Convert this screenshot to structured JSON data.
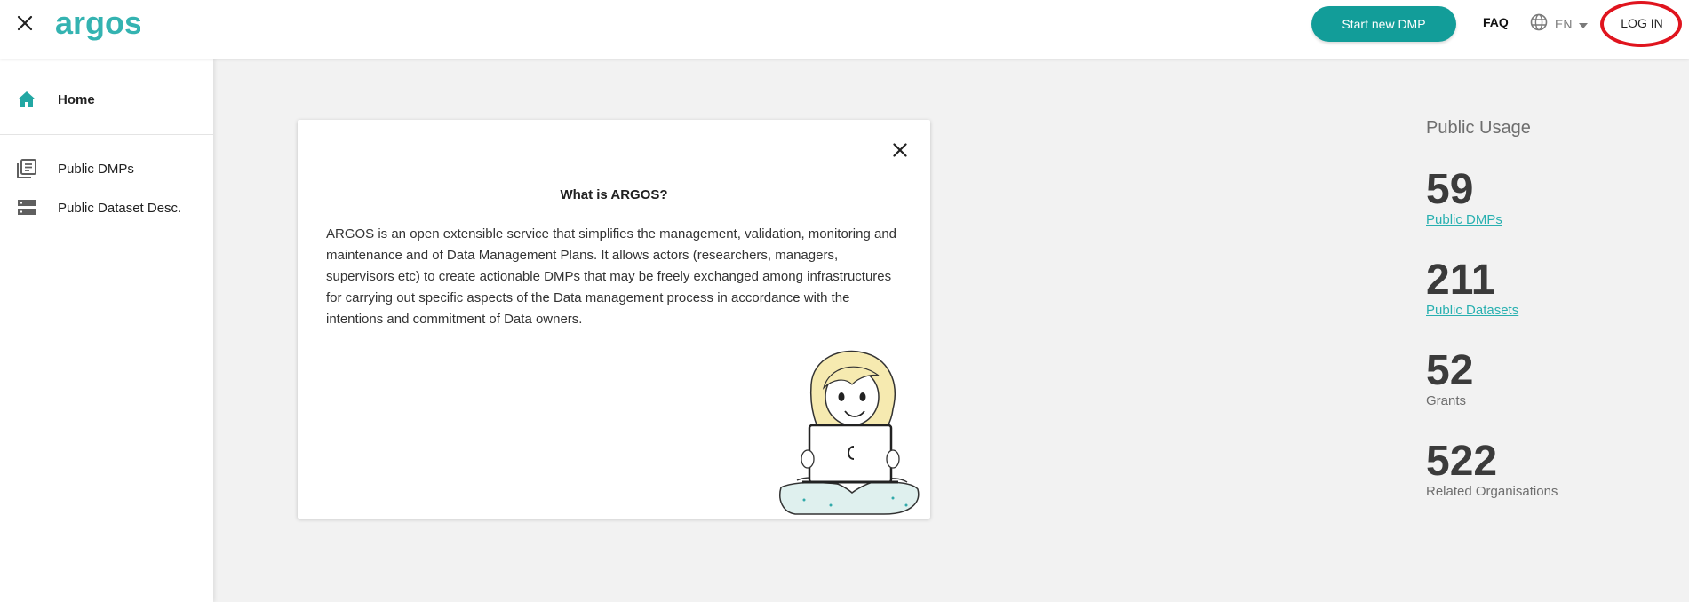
{
  "header": {
    "logo_text": "argos",
    "start_button_label": "Start new DMP",
    "faq_label": "FAQ",
    "language_label": "EN",
    "login_label": "LOG IN"
  },
  "sidebar": {
    "items": [
      {
        "label": "Home",
        "icon": "home-icon",
        "active": true
      },
      {
        "label": "Public DMPs",
        "icon": "library-books-icon",
        "active": false
      },
      {
        "label": "Public Dataset Desc.",
        "icon": "storage-icon",
        "active": false
      }
    ]
  },
  "info_card": {
    "title": "What is ARGOS?",
    "text": "ARGOS is an open extensible service that simplifies the management, validation, monitoring and maintenance and of Data Management Plans. It allows actors (researchers, managers, supervisors etc) to create actionable DMPs that may be freely exchanged among infrastructures for carrying out specific aspects of the Data management process in accordance with the intentions and commitment of Data owners."
  },
  "public_usage": {
    "title": "Public Usage",
    "stats": [
      {
        "value": "59",
        "label": "Public DMPs",
        "is_link": true
      },
      {
        "value": "211",
        "label": "Public Datasets",
        "is_link": true
      },
      {
        "value": "52",
        "label": "Grants",
        "is_link": false
      },
      {
        "value": "522",
        "label": "Related Organisations",
        "is_link": false
      }
    ]
  },
  "colors": {
    "accent": "#129d99",
    "link": "#28b0b0",
    "highlight_ring": "#e0141e",
    "background": "#f2f2f2"
  }
}
